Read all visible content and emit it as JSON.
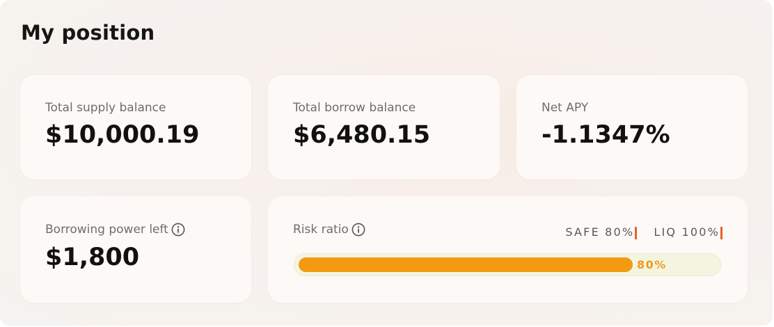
{
  "title": "My position",
  "cards": {
    "supply": {
      "label": "Total supply balance",
      "value": "$10,000.19"
    },
    "borrow": {
      "label": "Total borrow balance",
      "value": "$6,480.15"
    },
    "apy": {
      "label": "Net APY",
      "value": "-1.1347%"
    },
    "power": {
      "label": "Borrowing power left",
      "value": "$1,800",
      "icon": "info-icon"
    },
    "risk": {
      "label": "Risk ratio",
      "icon": "info-icon",
      "safe_label": "SAFE 80%",
      "liq_label": "LIQ 100%",
      "progress_percent": 80,
      "progress_label": "80%"
    }
  },
  "colors": {
    "bar_fill": "#f39a12",
    "bar_track": "#f3f5df",
    "threshold_tick": "#e4622f",
    "progress_text": "#f09a1c"
  }
}
